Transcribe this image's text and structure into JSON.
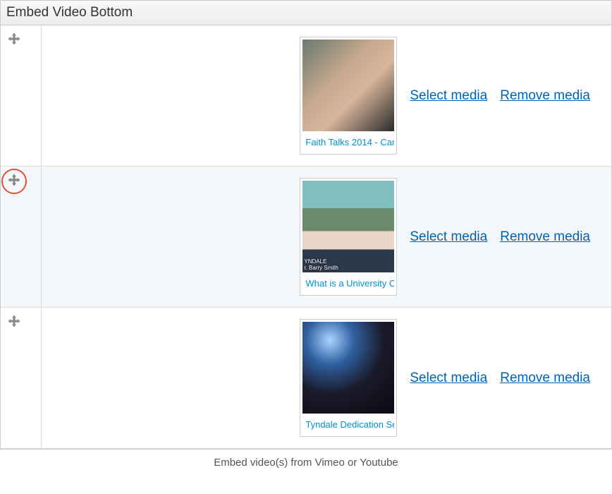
{
  "header": {
    "title": "Embed Video Bottom"
  },
  "rows": [
    {
      "caption": "Faith Talks 2014 - Car",
      "select_label": "Select media",
      "remove_label": "Remove media",
      "highlighted": false
    },
    {
      "caption": "What is a University Co",
      "thumb_overlay_name": "r. Barry Smith",
      "thumb_overlay_sub": "YNDALE",
      "select_label": "Select media",
      "remove_label": "Remove media",
      "highlighted": true
    },
    {
      "caption": "Tyndale Dedication Ser",
      "select_label": "Select media",
      "remove_label": "Remove media",
      "highlighted": false
    }
  ],
  "footer": {
    "hint": "Embed video(s) from Vimeo or Youtube"
  }
}
